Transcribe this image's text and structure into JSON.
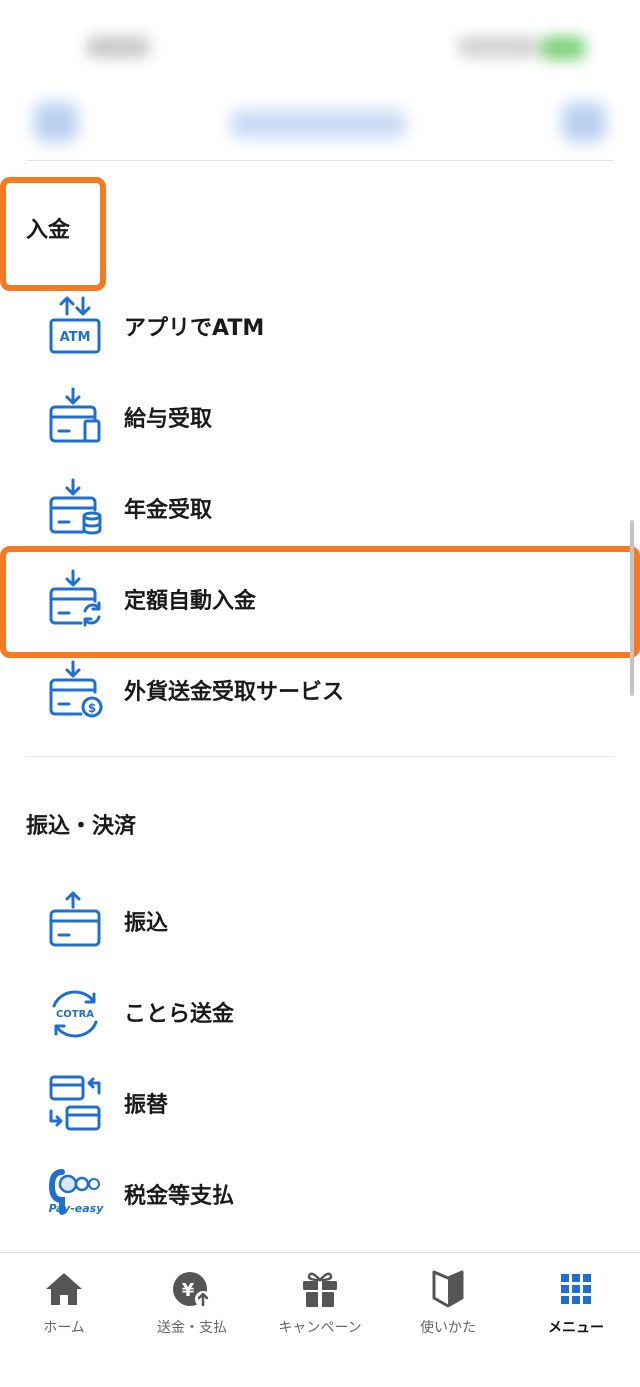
{
  "colors": {
    "accent": "#1f6fd1",
    "highlight": "#f57a22",
    "inactive_tab": "#555555"
  },
  "sections": [
    {
      "title": "入金",
      "items": [
        {
          "label": "アプリでATM",
          "icon": "atm-icon",
          "icon_text": "ATM"
        },
        {
          "label": "給与受取",
          "icon": "salary-receive-icon"
        },
        {
          "label": "年金受取",
          "icon": "pension-receive-icon"
        },
        {
          "label": "定額自動入金",
          "icon": "auto-deposit-icon"
        },
        {
          "label": "外貨送金受取サービス",
          "icon": "foreign-remittance-icon"
        }
      ]
    },
    {
      "title": "振込・決済",
      "items": [
        {
          "label": "振込",
          "icon": "transfer-icon"
        },
        {
          "label": "ことら送金",
          "icon": "cotra-icon",
          "icon_text": "COTRA"
        },
        {
          "label": "振替",
          "icon": "account-transfer-icon"
        },
        {
          "label": "税金等支払",
          "icon": "payeasy-icon",
          "icon_text": "Pay-easy"
        }
      ]
    }
  ],
  "tabbar": [
    {
      "label": "ホーム",
      "icon": "home-icon",
      "active": false
    },
    {
      "label": "送金・支払",
      "icon": "yen-send-icon",
      "active": false,
      "icon_text": "¥"
    },
    {
      "label": "キャンペーン",
      "icon": "gift-icon",
      "active": false
    },
    {
      "label": "使いかた",
      "icon": "beginner-icon",
      "active": false
    },
    {
      "label": "メニュー",
      "icon": "menu-grid-icon",
      "active": true
    }
  ]
}
